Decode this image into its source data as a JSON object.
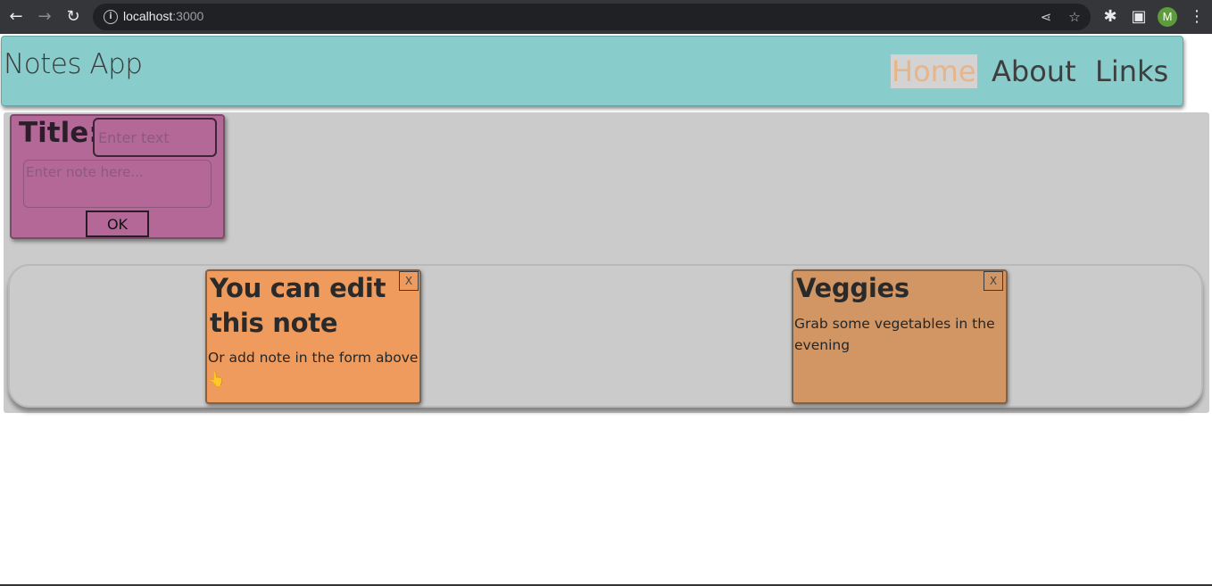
{
  "browser": {
    "url_host": "localhost",
    "url_port": ":3000",
    "profile_initial": "M",
    "icons": [
      "back-arrow-icon",
      "forward-arrow-icon",
      "reload-icon",
      "info-icon",
      "share-icon",
      "star-icon",
      "extensions-icon",
      "side-panel-icon",
      "more-menu-icon"
    ]
  },
  "header": {
    "title": "Notes App",
    "nav": [
      {
        "label": "Home",
        "active": true
      },
      {
        "label": "About",
        "active": false
      },
      {
        "label": "Links",
        "active": false
      }
    ]
  },
  "form": {
    "title_label": "Title:",
    "title_placeholder": "Enter text",
    "note_placeholder": "Enter note here...",
    "ok_label": "OK"
  },
  "notes": [
    {
      "title": "You can edit this note",
      "body": "Or add note in the form above 👆",
      "close_label": "X",
      "color": "#ee9b5d"
    },
    {
      "title": "Veggies",
      "body": "Grab some vegetables in the evening",
      "close_label": "X",
      "color": "#d19664"
    }
  ],
  "colors": {
    "header_bg": "#88cccb",
    "form_bg": "#b46897",
    "main_bg": "#cbcbcb",
    "active_nav": "#e8b489"
  }
}
